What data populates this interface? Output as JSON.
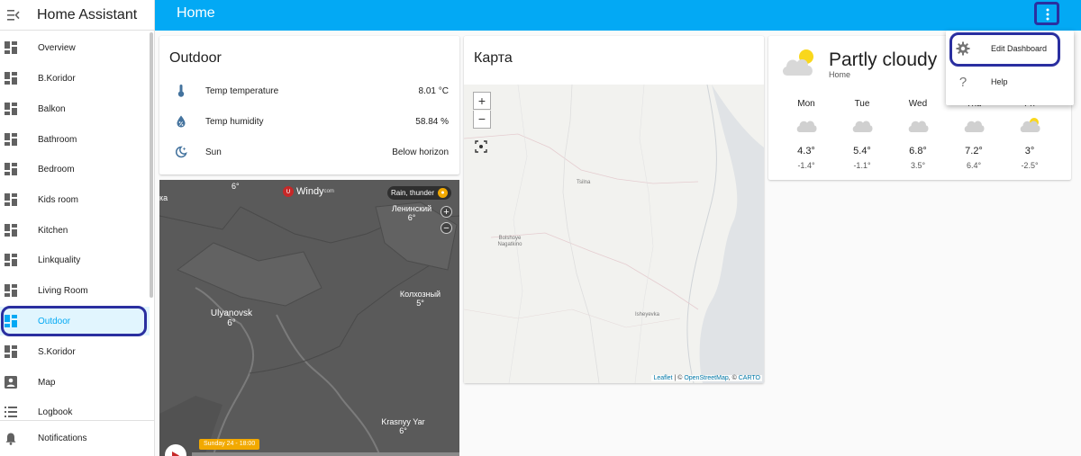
{
  "app": {
    "title": "Home Assistant"
  },
  "topbar": {
    "title": "Home"
  },
  "sidebar": {
    "items": [
      {
        "label": "Overview"
      },
      {
        "label": "B.Koridor"
      },
      {
        "label": "Balkon"
      },
      {
        "label": "Bathroom"
      },
      {
        "label": "Bedroom"
      },
      {
        "label": "Kids room"
      },
      {
        "label": "Kitchen"
      },
      {
        "label": "Linkquality"
      },
      {
        "label": "Living Room"
      },
      {
        "label": "Outdoor",
        "active": true
      },
      {
        "label": "S.Koridor"
      },
      {
        "label": "Map"
      },
      {
        "label": "Logbook"
      }
    ],
    "notifications": "Notifications"
  },
  "outdoor_card": {
    "title": "Outdoor",
    "rows": [
      {
        "icon": "thermometer-icon",
        "name": "Temp temperature",
        "value": "8.01 °C"
      },
      {
        "icon": "water-percent-icon",
        "name": "Temp humidity",
        "value": "58.84 %"
      },
      {
        "icon": "weather-night-icon",
        "name": "Sun",
        "value": "Below horizon"
      }
    ]
  },
  "windy": {
    "brand": "Windy",
    "brand_suffix": "com",
    "layer": "Rain, thunder",
    "cities": [
      {
        "name": "Ulyanovsk",
        "temp": "6°"
      },
      {
        "name": "Ленинский",
        "temp": "6°"
      },
      {
        "name": "Колхозный",
        "temp": "5°"
      },
      {
        "name": "Krasnyy Yar",
        "temp": "6°"
      }
    ],
    "top_temp": "6°",
    "left_fragment": "ка",
    "timeline": "Sunday 24 - 18:00"
  },
  "map_card": {
    "title": "Карта",
    "zoom_in": "+",
    "zoom_out": "−",
    "places": [
      "Tsilna",
      "Bolshoye Nagatkino",
      "Isheyevka"
    ],
    "attribution": {
      "leaflet": "Leaflet",
      "sep1": " | © ",
      "osm": "OpenStreetMap",
      "sep2": ", © ",
      "carto": "CARTO"
    }
  },
  "weather_card": {
    "condition": "Partly cloudy",
    "location": "Home",
    "forecast": [
      {
        "day": "Mon",
        "hi": "4.3°",
        "lo": "-1.4°",
        "icon": "cloudy-icon"
      },
      {
        "day": "Tue",
        "hi": "5.4°",
        "lo": "-1.1°",
        "icon": "cloudy-icon"
      },
      {
        "day": "Wed",
        "hi": "6.8°",
        "lo": "3.5°",
        "icon": "cloudy-icon"
      },
      {
        "day": "Thu",
        "hi": "7.2°",
        "lo": "6.4°",
        "icon": "cloudy-icon"
      },
      {
        "day": "Fri",
        "hi": "3°",
        "lo": "-2.5°",
        "icon": "partly-cloudy-icon"
      }
    ]
  },
  "overflow_menu": {
    "items": [
      {
        "icon": "gear-icon",
        "label": "Edit Dashboard"
      },
      {
        "icon": "help-icon",
        "label": "Help"
      }
    ]
  },
  "colors": {
    "primary": "#03a9f4",
    "highlight": "#2a2fa0",
    "active_bg": "#e1f5fe"
  }
}
